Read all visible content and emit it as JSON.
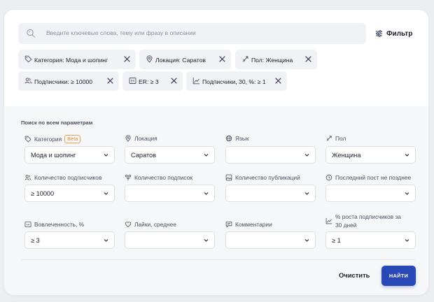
{
  "search": {
    "placeholder": "Введите ключевые слова, тему или фразу в описании",
    "filter_label": "Фильтр"
  },
  "active_filters": [
    {
      "label": "Категория: Мода и шопинг",
      "icon": "tag-icon"
    },
    {
      "label": "Локация: Саратов",
      "icon": "location-pin-icon"
    },
    {
      "label": "Пол: Женщина",
      "icon": "gender-icon"
    },
    {
      "label": "Подписчики: ≥ 10000",
      "icon": "followers-icon"
    },
    {
      "label": "ER: ≥ 3",
      "icon": "er-icon"
    },
    {
      "label": "Подписчики, 30, %: ≥ 1",
      "icon": "growth-chart-icon"
    }
  ],
  "form": {
    "section_title": "Поиск по всем параметрам",
    "fields": [
      {
        "label": "Категория",
        "badge": "Beta",
        "value": "Мода и шопинг",
        "icon": "tag-icon"
      },
      {
        "label": "Локация",
        "value": "Саратов",
        "icon": "location-pin-icon"
      },
      {
        "label": "Язык",
        "value": "",
        "icon": "globe-icon"
      },
      {
        "label": "Пол",
        "value": "Женщина",
        "icon": "gender-icon"
      },
      {
        "label": "Количество подписчиков",
        "value": "≥ 10000",
        "icon": "followers-icon"
      },
      {
        "label": "Количество подписок",
        "value": "",
        "icon": "subscriptions-icon"
      },
      {
        "label": "Количество публикаций",
        "value": "",
        "icon": "image-icon"
      },
      {
        "label": "Последний пост не позднее",
        "value": "",
        "icon": "clock-icon"
      },
      {
        "label": "Вовлеченность, %",
        "value": "≥ 3",
        "icon": "er-icon"
      },
      {
        "label": "Лайки, среднее",
        "value": "",
        "icon": "heart-icon"
      },
      {
        "label": "Комментарии",
        "value": "",
        "icon": "comment-icon"
      },
      {
        "label": "% роста подписчиков за 30 дней",
        "value": "≥ 1",
        "icon": "growth-chart-icon"
      }
    ]
  },
  "actions": {
    "clear_label": "Очистить",
    "find_label": "НАЙТИ"
  },
  "colors": {
    "accent": "#2a47b8",
    "beta_badge": "#e88a30",
    "page_bg": "#eceef2"
  }
}
